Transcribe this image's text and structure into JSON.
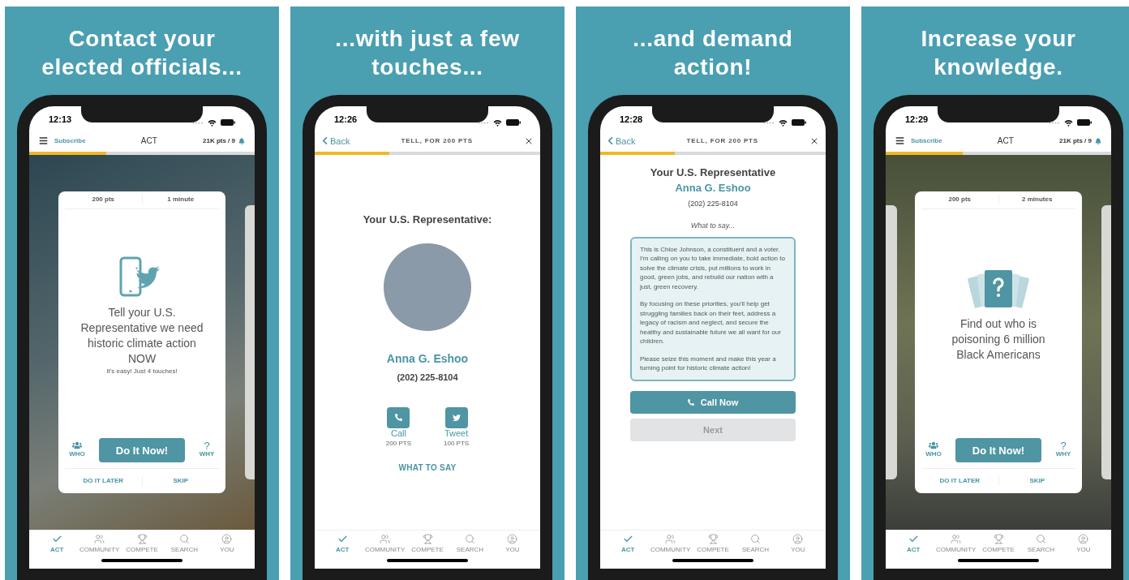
{
  "panels": [
    {
      "caption": "Contact your\nelected officials...",
      "time": "12:13",
      "header": {
        "kind": "act",
        "subscribe": "Subscribe",
        "title": "ACT",
        "points": "21K pts / 9"
      },
      "progress": {
        "level": 0.34
      },
      "body": {
        "kind": "tweet-card",
        "previous_card": false,
        "points": "200 pts",
        "duration": "1 minute",
        "headline": "Tell your U.S. Representative we need historic climate action NOW",
        "subtext": "It's easy! Just 4 touches!",
        "who": "WHO",
        "action": "Do It Now!",
        "why_mark": "?",
        "why": "WHY",
        "later": "DO IT LATER",
        "skip": "SKIP"
      },
      "nav": [
        {
          "kind": "act",
          "label": "ACT",
          "selected": true
        },
        {
          "kind": "community",
          "label": "COMMUNITY",
          "selected": false
        },
        {
          "kind": "compete",
          "label": "COMPETE",
          "selected": false
        },
        {
          "kind": "search",
          "label": "SEARCH",
          "selected": false
        },
        {
          "kind": "you",
          "label": "YOU",
          "selected": false
        }
      ]
    },
    {
      "caption": "...with just a few\ntouches...",
      "time": "12:26",
      "header": {
        "kind": "tell",
        "back": "Back",
        "title": "TELL, FOR 200 PTS"
      },
      "progress": {
        "level": 0.33
      },
      "body": {
        "kind": "representative",
        "heading": "Your U.S. Representative:",
        "name": "Anna G. Eshoo",
        "phone": "(202) 225-8104",
        "actions": [
          {
            "kind": "call",
            "label": "Call",
            "points": "200 PTS"
          },
          {
            "kind": "tweet",
            "label": "Tweet",
            "points": "100 PTS"
          }
        ],
        "link": "WHAT TO SAY"
      },
      "nav": [
        {
          "kind": "act",
          "label": "ACT",
          "selected": true
        },
        {
          "kind": "community",
          "label": "COMMUNITY",
          "selected": false
        },
        {
          "kind": "compete",
          "label": "COMPETE",
          "selected": false
        },
        {
          "kind": "search",
          "label": "SEARCH",
          "selected": false
        },
        {
          "kind": "you",
          "label": "YOU",
          "selected": false
        }
      ]
    },
    {
      "caption": "...and demand\naction!",
      "time": "12:28",
      "header": {
        "kind": "tell",
        "back": "Back",
        "title": "TELL, FOR 200 PTS"
      },
      "progress": {
        "level": 0.33
      },
      "body": {
        "kind": "script",
        "heading": "Your U.S. Representative",
        "name": "Anna G. Eshoo",
        "phone": "(202) 225-8104",
        "prompt": "What to say...",
        "paragraphs": [
          "This is Chloe Johnson, a constituent and a voter. I'm calling on you to take immediate, bold action to solve the climate crisis, put millions to work in good, green jobs, and rebuild our nation with a just, green recovery.",
          "By focusing on these priorities, you'll help get struggling families back on their feet, address a legacy of racism and neglect, and secure the healthy and sustainable future we all want for our children.",
          "Please seize this moment and make this year a turning point for historic climate action!"
        ],
        "primary": "Call Now",
        "secondary": {
          "label": "Next",
          "disabled": true
        }
      },
      "nav": [
        {
          "kind": "act",
          "label": "ACT",
          "selected": true
        },
        {
          "kind": "community",
          "label": "COMMUNITY",
          "selected": false
        },
        {
          "kind": "compete",
          "label": "COMPETE",
          "selected": false
        },
        {
          "kind": "search",
          "label": "SEARCH",
          "selected": false
        },
        {
          "kind": "you",
          "label": "YOU",
          "selected": false
        }
      ]
    },
    {
      "caption": "Increase your\nknowledge.",
      "time": "12:29",
      "header": {
        "kind": "act",
        "subscribe": "Subscribe",
        "title": "ACT",
        "points": "21K pts / 9"
      },
      "progress": {
        "level": 0.34
      },
      "body": {
        "kind": "quiz-card",
        "previous_card": true,
        "points": "200 pts",
        "duration": "2 minutes",
        "headline": "Find out who is poisoning 6 million Black Americans",
        "who": "WHO",
        "action": "Do It Now!",
        "why_mark": "?",
        "why": "WHY",
        "later": "DO IT LATER",
        "skip": "SKIP"
      },
      "nav": [
        {
          "kind": "act",
          "label": "ACT",
          "selected": true
        },
        {
          "kind": "community",
          "label": "COMMUNITY",
          "selected": false
        },
        {
          "kind": "compete",
          "label": "COMPETE",
          "selected": false
        },
        {
          "kind": "search",
          "label": "SEARCH",
          "selected": false
        },
        {
          "kind": "you",
          "label": "YOU",
          "selected": false
        }
      ]
    }
  ]
}
